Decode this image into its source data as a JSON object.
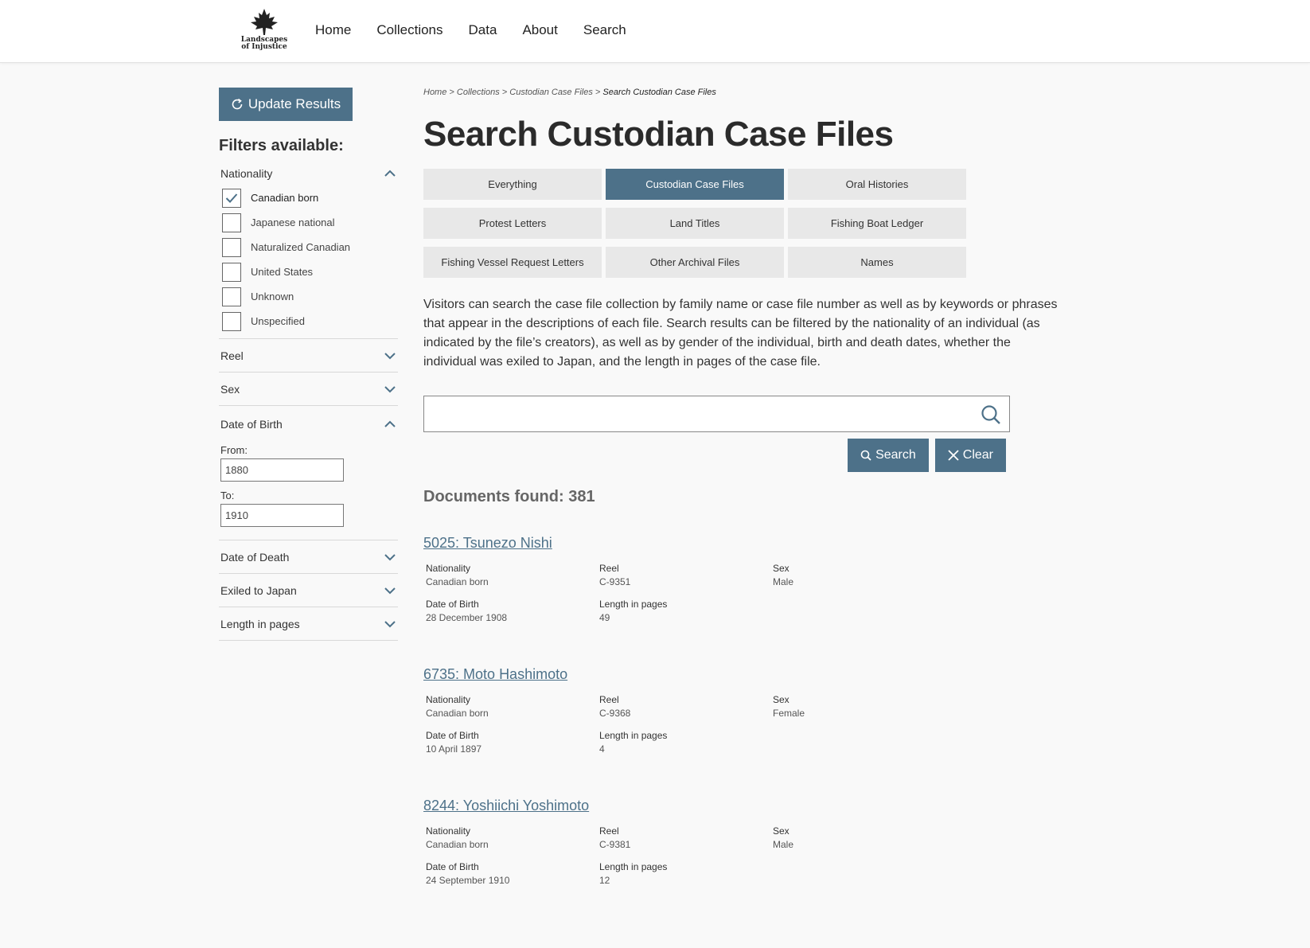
{
  "logo": {
    "line1": "Landscapes",
    "line2": "of Injustice"
  },
  "nav": [
    "Home",
    "Collections",
    "Data",
    "About",
    "Search"
  ],
  "sidebar": {
    "update_label": "Update Results",
    "filters_title": "Filters available:",
    "nationality": {
      "label": "Nationality",
      "options": [
        {
          "label": "Canadian born",
          "checked": true
        },
        {
          "label": "Japanese national",
          "checked": false
        },
        {
          "label": "Naturalized Canadian",
          "checked": false
        },
        {
          "label": "United States",
          "checked": false
        },
        {
          "label": "Unknown",
          "checked": false
        },
        {
          "label": "Unspecified",
          "checked": false
        }
      ]
    },
    "reel": "Reel",
    "sex": "Sex",
    "dob": {
      "label": "Date of Birth",
      "from_label": "From:",
      "from_value": "1880",
      "to_label": "To:",
      "to_value": "1910"
    },
    "dod": "Date of Death",
    "exiled": "Exiled to Japan",
    "length": "Length in pages"
  },
  "breadcrumb": {
    "home": "Home",
    "sep": ">",
    "collections": "Collections",
    "ccf": "Custodian Case Files",
    "current": "Search Custodian Case Files"
  },
  "title": "Search Custodian Case Files",
  "tabs": [
    "Everything",
    "Custodian Case Files",
    "Oral Histories",
    "Protest Letters",
    "Land Titles",
    "Fishing Boat Ledger",
    "Fishing Vessel Request Letters",
    "Other Archival Files",
    "Names"
  ],
  "active_tab": "Custodian Case Files",
  "description": "Visitors can search the case file collection by family name or case file number as well as by keywords or phrases that appear in the descriptions of each file. Search results can be filtered by the nationality of an individual (as indicated by the file’s creators), as well as by gender of the individual, birth and death dates, whether the individual was exiled to Japan, and the length in pages of the case file.",
  "search": {
    "value": "",
    "search_label": "Search",
    "clear_label": "Clear"
  },
  "found_text": "Documents found: 381",
  "field_labels": {
    "nationality": "Nationality",
    "reel": "Reel",
    "sex": "Sex",
    "dob": "Date of Birth",
    "length": "Length in pages"
  },
  "results": [
    {
      "title": "5025: Tsunezo Nishi",
      "nationality": "Canadian born",
      "reel": "C-9351",
      "sex": "Male",
      "dob": "28 December 1908",
      "length": "49"
    },
    {
      "title": "6735: Moto Hashimoto",
      "nationality": "Canadian born",
      "reel": "C-9368",
      "sex": "Female",
      "dob": "10 April 1897",
      "length": "4"
    },
    {
      "title": "8244: Yoshiichi Yoshimoto",
      "nationality": "Canadian born",
      "reel": "C-9381",
      "sex": "Male",
      "dob": "24 September 1910",
      "length": "12"
    }
  ],
  "colors": {
    "accent": "#4d7189",
    "tab_bg": "#e8e8e8",
    "page_bg": "#f9f9f9"
  }
}
